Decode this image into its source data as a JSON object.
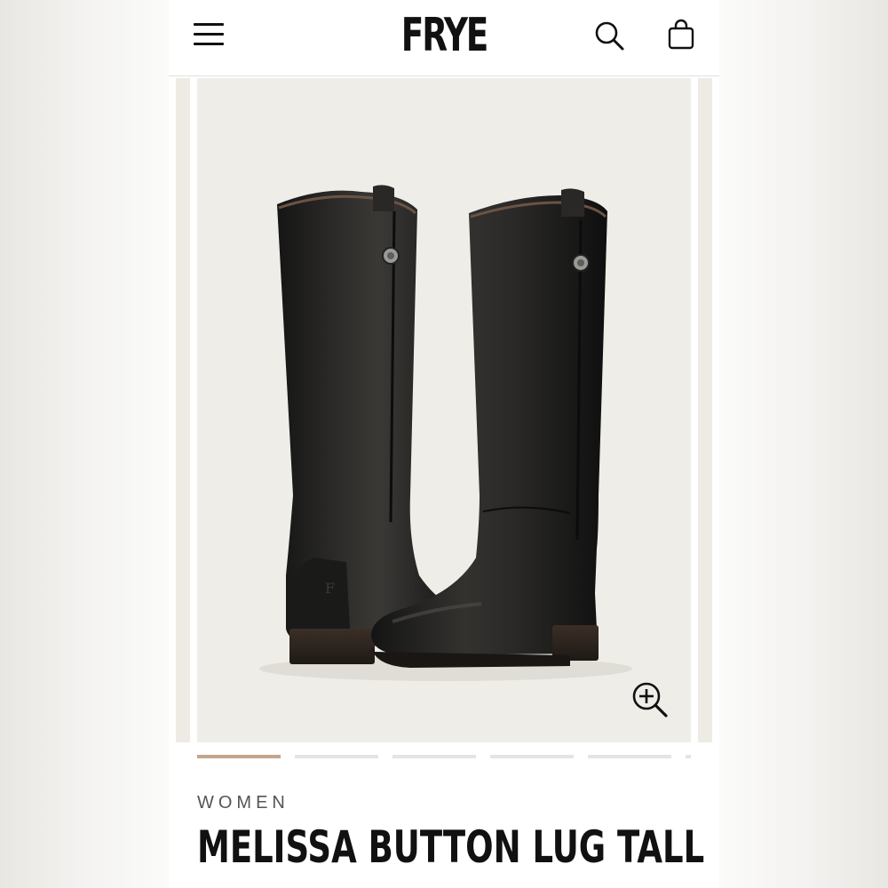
{
  "header": {
    "logo": "FRYE",
    "menu_icon": "hamburger-menu-icon",
    "search_icon": "search-icon",
    "bag_icon": "shopping-bag-icon"
  },
  "gallery": {
    "image_alt": "Pair of tall black leather riding boots with button detail",
    "zoom_icon": "zoom-in-icon",
    "slide_count": 6,
    "active_slide": 1
  },
  "product": {
    "category": "WOMEN",
    "name": "MELISSA BUTTON LUG TALL"
  },
  "colors": {
    "accent": "#c4a68c",
    "text": "#111111",
    "image_bg": "#efede8"
  }
}
